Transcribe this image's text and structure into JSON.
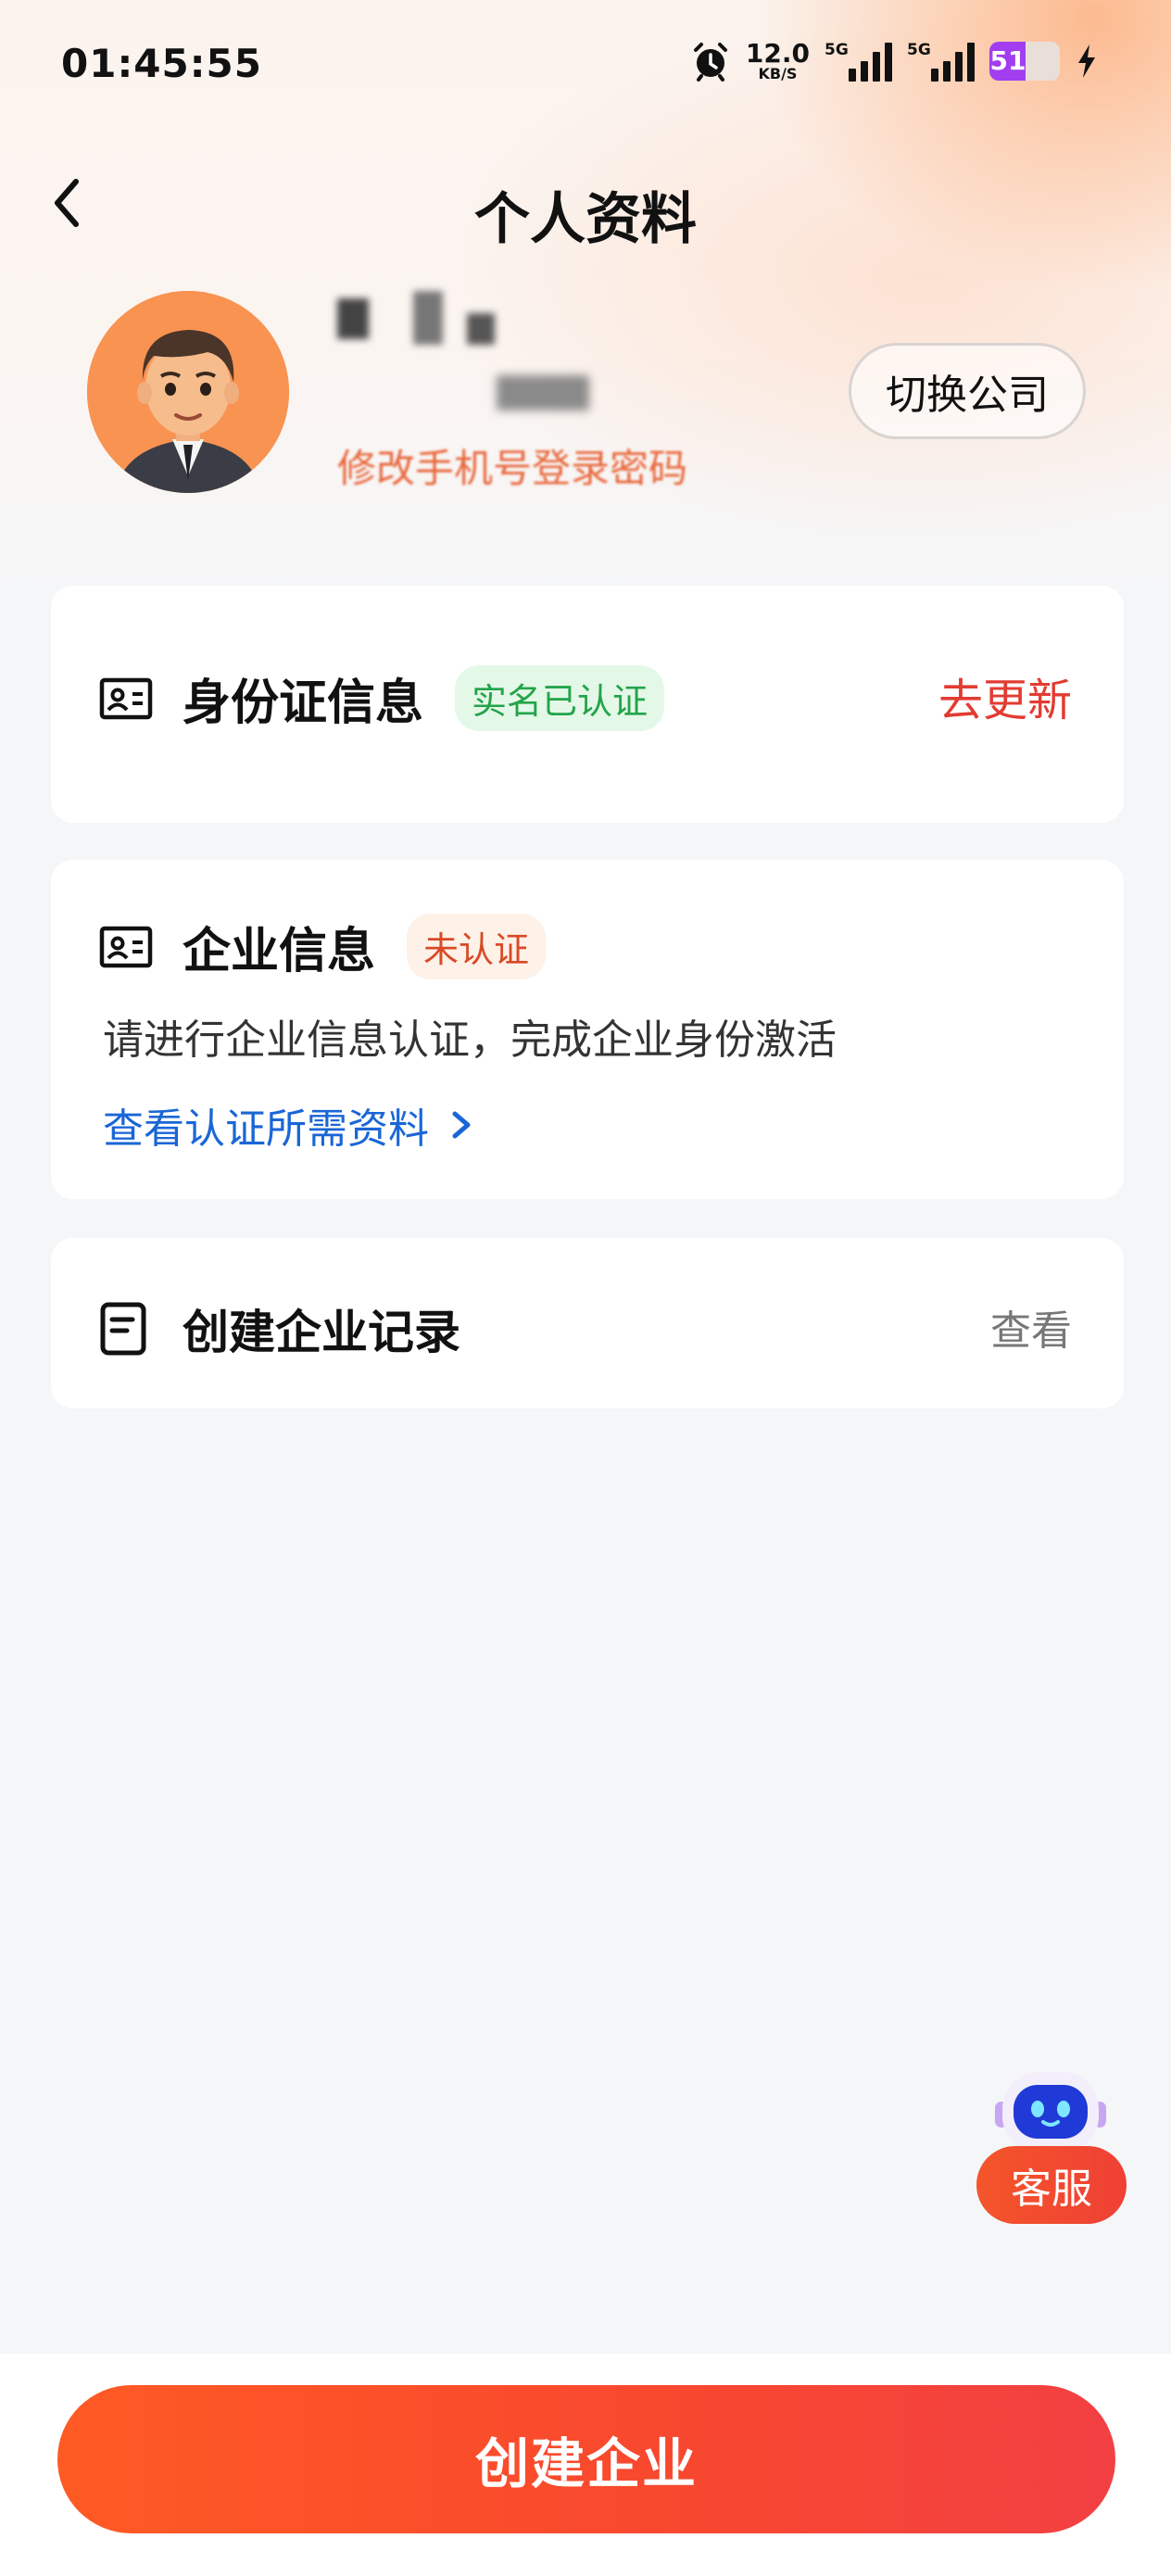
{
  "status_bar": {
    "time": "01:45:55",
    "net_speed": "12.0",
    "net_unit": "KB/S",
    "sim1_label": "5G",
    "sim2_label": "5G",
    "battery": "51",
    "battery_level": 0.51
  },
  "nav": {
    "title": "个人资料",
    "back_icon": "chevron-left-icon"
  },
  "profile": {
    "change_password_label": "修改手机号登录密码",
    "switch_company_label": "切换公司"
  },
  "cards": {
    "id_info": {
      "title": "身份证信息",
      "badge": "实名已认证",
      "action": "去更新",
      "icon": "id-card-icon"
    },
    "enterprise_info": {
      "title": "企业信息",
      "badge": "未认证",
      "description": "请进行企业信息认证，完成企业身份激活",
      "link": "查看认证所需资料",
      "icon": "id-card-icon"
    },
    "create_record": {
      "title": "创建企业记录",
      "action": "查看",
      "icon": "document-icon"
    }
  },
  "service": {
    "label": "客服"
  },
  "bottom": {
    "create_label": "创建企业"
  },
  "colors": {
    "accent": "#f8472f",
    "verified_green": "#23a44a",
    "link_blue": "#1a66d6",
    "warning_red": "#e23b32"
  }
}
